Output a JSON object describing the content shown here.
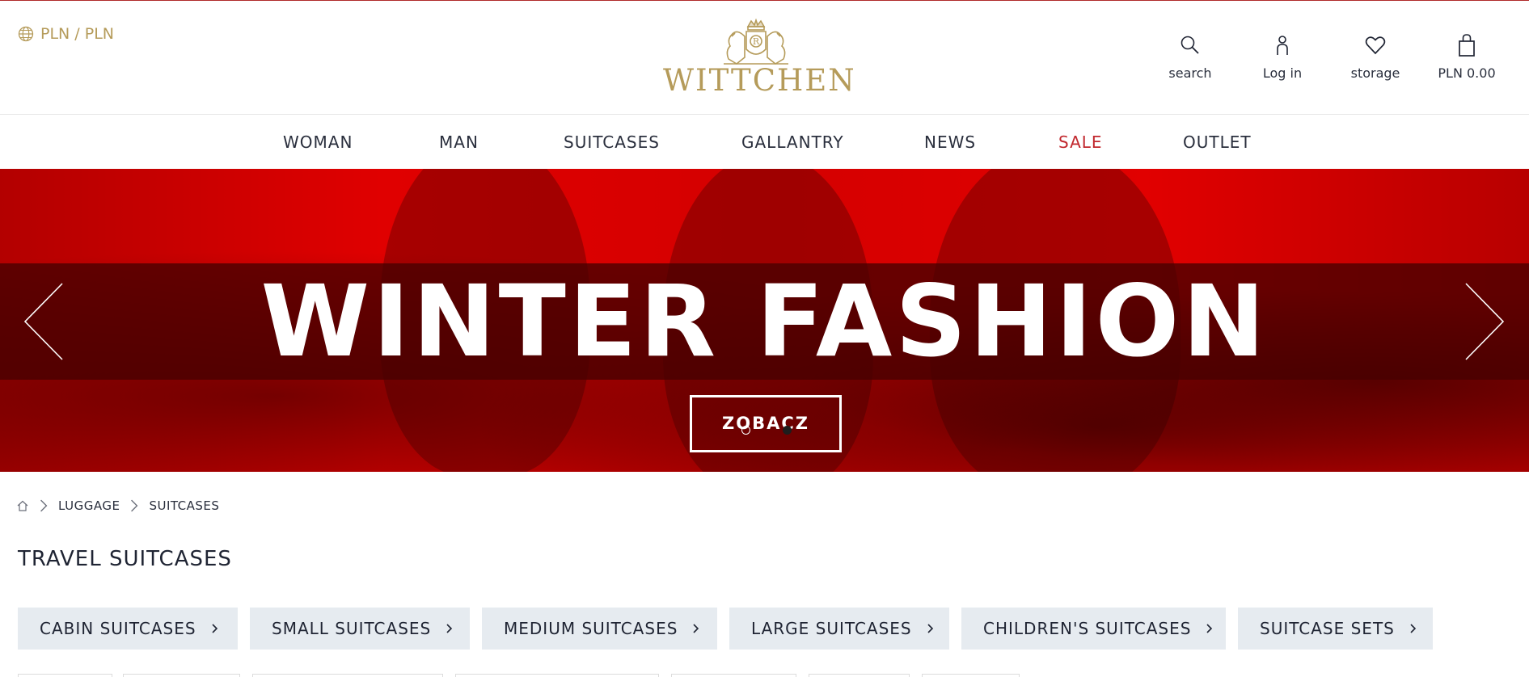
{
  "header": {
    "currency": "PLN / PLN",
    "logo_text": "WITTCHEN",
    "tools": {
      "search": "search",
      "login": "Log in",
      "storage": "storage",
      "cart": "PLN 0.00"
    }
  },
  "nav": {
    "items": [
      "WOMAN",
      "MAN",
      "SUITCASES",
      "GALLANTRY",
      "NEWS",
      "SALE",
      "OUTLET"
    ]
  },
  "hero": {
    "title": "WINTER FASHION",
    "button": "ZOBACZ"
  },
  "breadcrumb": {
    "items": [
      "LUGGAGE",
      "SUITCASES"
    ]
  },
  "page": {
    "title": "TRAVEL SUITCASES"
  },
  "categories": [
    "CABIN SUITCASES",
    "SMALL SUITCASES",
    "MEDIUM SUITCASES",
    "LARGE SUITCASES",
    "CHILDREN'S SUITCASES",
    "SUITCASE SETS"
  ],
  "colors": {
    "gold": "#b59b5a",
    "sale": "#c1272d",
    "hero_red": "#e00000",
    "chip_bg": "#e6ebf0"
  },
  "icons": [
    "globe-icon",
    "search-icon",
    "user-icon",
    "heart-icon",
    "bag-icon",
    "home-icon",
    "chevron-right-icon",
    "chevron-left-icon"
  ]
}
